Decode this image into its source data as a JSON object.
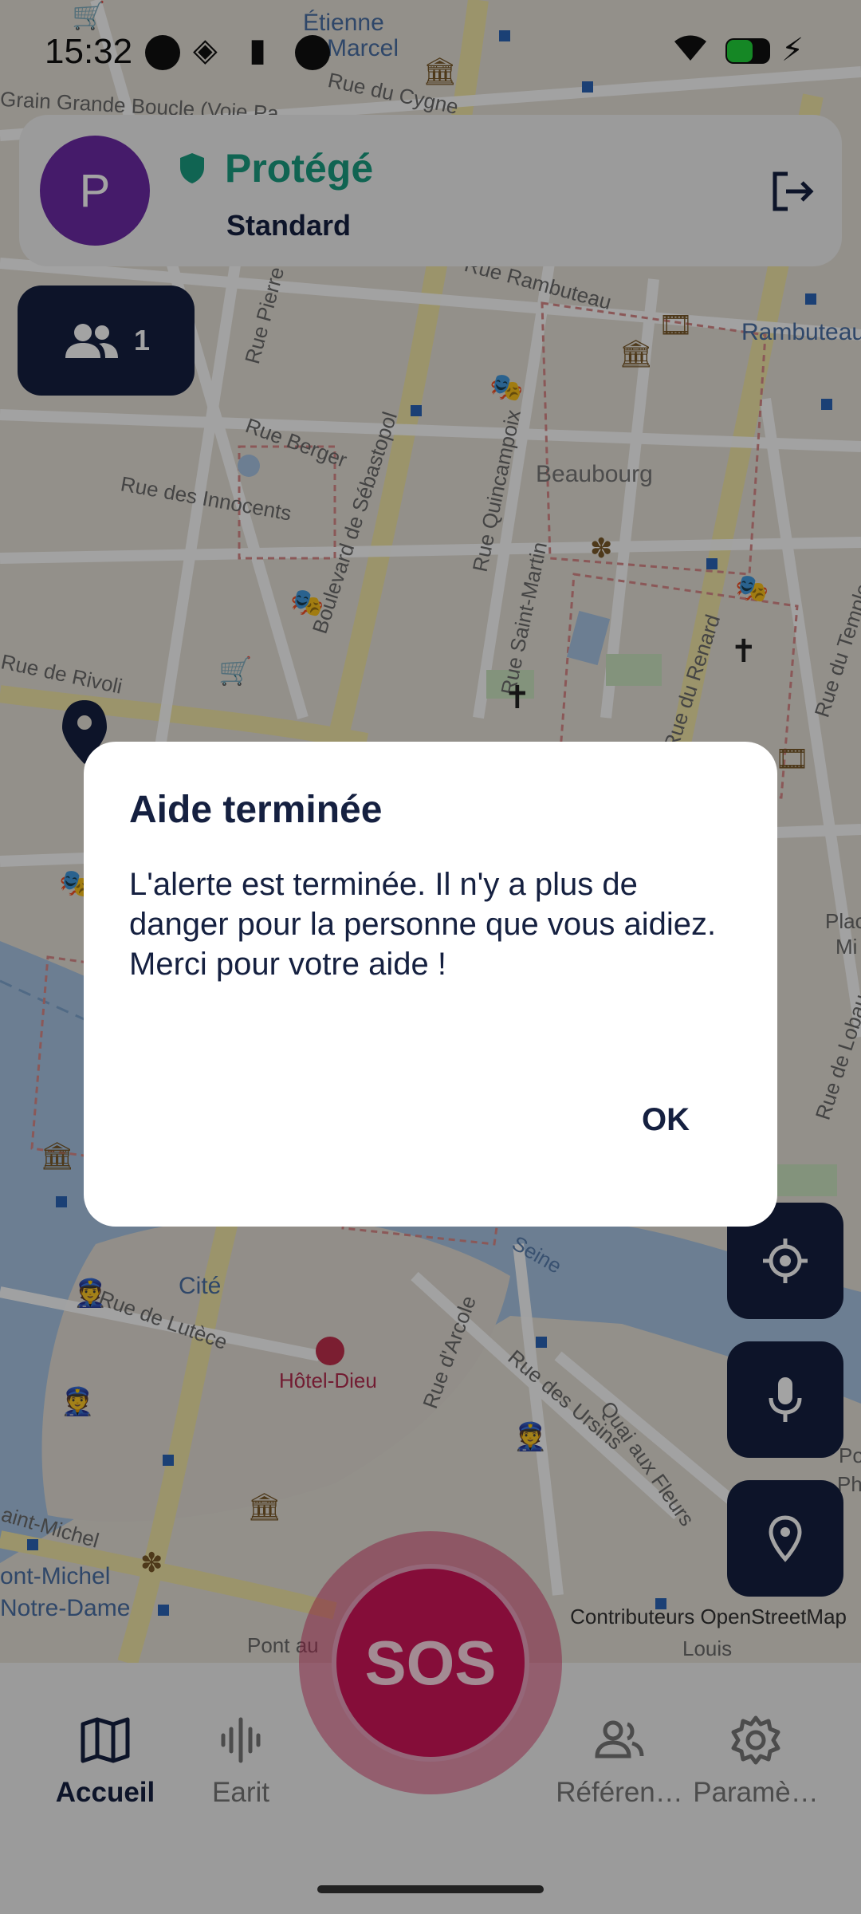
{
  "status_bar": {
    "time": "15:32"
  },
  "header": {
    "avatar_initial": "P",
    "status": "Protégé",
    "plan": "Standard",
    "status_color": "#1a9d80",
    "avatar_color": "#6d2ba6"
  },
  "group": {
    "count": "1"
  },
  "map": {
    "labels": {
      "etienne": "Étienne",
      "marcel": "Marcel",
      "rue_du_cygne": "Rue du Cygne",
      "grain_grande_boucle": "Grain Grande Boucle (Voie Pa",
      "rue_rambuteau": "Rue Rambuteau",
      "rambuteau": "Rambuteau",
      "rue_pierre": "Rue Pierre",
      "rue_berger": "Rue Berger",
      "rue_des_innocents": "Rue des Innocents",
      "boulevard_sebastopol": "Boulevard de Sébastopol",
      "rue_quincampoix": "Rue Quincampoix",
      "beaubourg": "Beaubourg",
      "rue_saint_martin": "Rue Saint-Martin",
      "rue_renard": "Rue du Renard",
      "rue_du_temple": "Rue du Temple",
      "rue_rivoli": "Rue de Rivoli",
      "place_hotel": "Place H",
      "mi": "Mi",
      "rue_lobau": "Rue de Lobau",
      "cite": "Cité",
      "rue_lutece": "Rue de Lutèce",
      "hotel_dieu": "Hôtel-Dieu",
      "rue_arcole": "Rue d'Arcole",
      "rue_ursins": "Rue des Ursins",
      "quai_fleurs": "Quai aux Fleurs",
      "seine": "Seine",
      "saint_michel": "aint-Michel",
      "ont_michel": "ont-Michel",
      "notre_dame": "Notre-Dame",
      "pont": "Pont",
      "pont_au": "Pont au",
      "louis": "Louis",
      "pont_right": "Pont",
      "phi": "Phi"
    },
    "attribution": "Contributeurs OpenStreetMap"
  },
  "sos": {
    "label": "SOS"
  },
  "dialog": {
    "title": "Aide terminée",
    "body_line1": "L'alerte est terminée. Il n'y a plus de danger pour la personne que vous aidiez.",
    "body_line2": "Merci pour votre aide !",
    "ok_label": "OK"
  },
  "bottom_nav": {
    "items": [
      {
        "label": "Accueil",
        "icon": "map-icon"
      },
      {
        "label": "Earit",
        "icon": "audio-wave-icon"
      },
      {
        "label": "Référen…",
        "icon": "people-icon"
      },
      {
        "label": "Paramè…",
        "icon": "gear-icon"
      }
    ]
  },
  "colors": {
    "navy": "#152040",
    "sos": "#d0155a",
    "teal": "#1a9d80"
  }
}
